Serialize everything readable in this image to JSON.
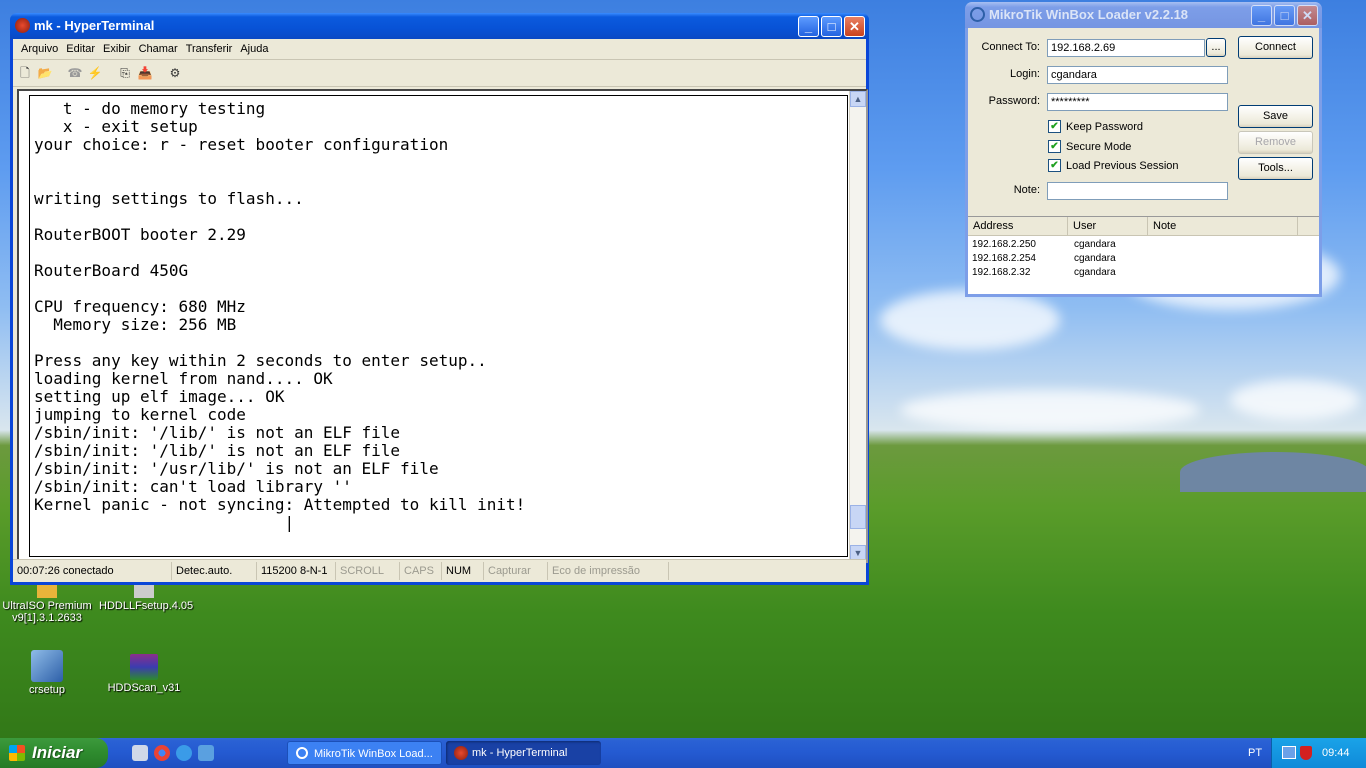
{
  "desktop": {
    "icons": [
      {
        "name": "UltraISO Premium v9[1].3.1.2633"
      },
      {
        "name": "HDDLLFsetup.4.05"
      },
      {
        "name": "crsetup"
      },
      {
        "name": "HDDScan_v31"
      }
    ]
  },
  "hyperterminal": {
    "title": "mk - HyperTerminal",
    "menu": [
      "Arquivo",
      "Editar",
      "Exibir",
      "Chamar",
      "Transferir",
      "Ajuda"
    ],
    "terminal_text": "   t - do memory testing\n   x - exit setup\nyour choice: r - reset booter configuration\n\n\nwriting settings to flash...\n\nRouterBOOT booter 2.29\n\nRouterBoard 450G\n\nCPU frequency: 680 MHz\n  Memory size: 256 MB\n\nPress any key within 2 seconds to enter setup..\nloading kernel from nand.... OK\nsetting up elf image... OK\njumping to kernel code\n/sbin/init: '/lib/' is not an ELF file\n/sbin/init: '/lib/' is not an ELF file\n/sbin/init: '/usr/lib/' is not an ELF file\n/sbin/init: can't load library ''\nKernel panic - not syncing: Attempted to kill init!\n                          |",
    "status": {
      "connection": "00:07:26 conectado",
      "detect": "Detec.auto.",
      "params": "115200 8-N-1",
      "scroll": "SCROLL",
      "caps": "CAPS",
      "num": "NUM",
      "capture": "Capturar",
      "echo": "Eco de impressão"
    }
  },
  "winbox": {
    "title": "MikroTik WinBox Loader v2.2.18",
    "connect_to_label": "Connect To:",
    "connect_to_value": "192.168.2.69",
    "browse_label": "...",
    "connect_button": "Connect",
    "login_label": "Login:",
    "login_value": "cgandara",
    "password_label": "Password:",
    "password_value": "*********",
    "save_button": "Save",
    "remove_button": "Remove",
    "tools_button": "Tools...",
    "keep_password": "Keep Password",
    "secure_mode": "Secure Mode",
    "load_previous": "Load Previous Session",
    "note_label": "Note:",
    "note_value": "",
    "columns": [
      "Address",
      "User",
      "Note"
    ],
    "rows": [
      {
        "address": "192.168.2.250",
        "user": "cgandara",
        "note": ""
      },
      {
        "address": "192.168.2.254",
        "user": "cgandara",
        "note": ""
      },
      {
        "address": "192.168.2.32",
        "user": "cgandara",
        "note": ""
      }
    ]
  },
  "taskbar": {
    "start_label": "Iniciar",
    "tasks": [
      "MikroTik WinBox Load...",
      "mk - HyperTerminal"
    ],
    "language": "PT",
    "clock": "09:44"
  }
}
